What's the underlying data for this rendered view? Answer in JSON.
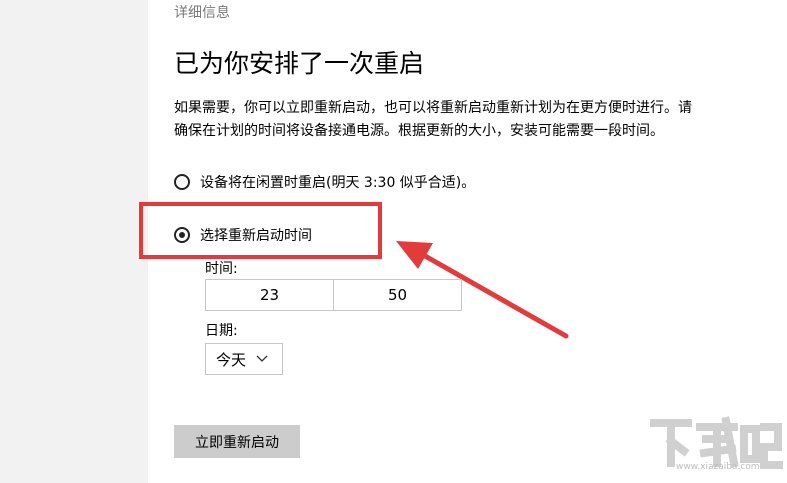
{
  "section_label": "详细信息",
  "title": "已为你安排了一次重启",
  "description": {
    "line1": "如果需要，你可以立即重新启动，也可以将重新启动重新计划为在更方便时进行。请",
    "line2": "确保在计划的时间将设备接通电源。根据更新的大小，安装可能需要一段时间。"
  },
  "options": [
    {
      "label": "设备将在闲置时重启(明天 3:30 似乎合适)。",
      "selected": false
    },
    {
      "label": "选择重新启动时间",
      "selected": true
    }
  ],
  "time": {
    "label": "时间:",
    "hour": "23",
    "minute": "50"
  },
  "date": {
    "label": "日期:",
    "value": "今天"
  },
  "restart_button": "立即重新启动",
  "annotation_color": "#e33b3b",
  "watermark": {
    "logo": "下载吧",
    "site": "www.xiazaiba.com"
  }
}
